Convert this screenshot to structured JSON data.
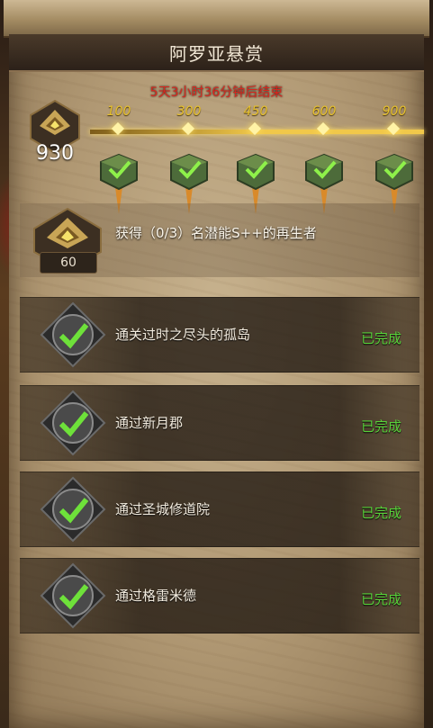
{
  "title": "阿罗亚悬赏",
  "countdown": "5天3小时36分钟后结束",
  "current_points": "930",
  "milestones": [
    {
      "value": "100",
      "claimed": true
    },
    {
      "value": "300",
      "claimed": true
    },
    {
      "value": "450",
      "claimed": true
    },
    {
      "value": "600",
      "claimed": true
    },
    {
      "value": "900",
      "claimed": true
    }
  ],
  "reward_task": {
    "label": "获得（0/3）名潜能S++的再生者",
    "points": "60"
  },
  "tasks": [
    {
      "label": "通关过时之尽头的孤岛",
      "status": "已完成"
    },
    {
      "label": "通过新月郡",
      "status": "已完成"
    },
    {
      "label": "通过圣城修道院",
      "status": "已完成"
    },
    {
      "label": "通过格雷米德",
      "status": "已完成"
    }
  ],
  "colors": {
    "countdown": "#d8271e",
    "complete": "#58d13a",
    "milestone": "#e7c12d",
    "check": "#6ee13a"
  }
}
